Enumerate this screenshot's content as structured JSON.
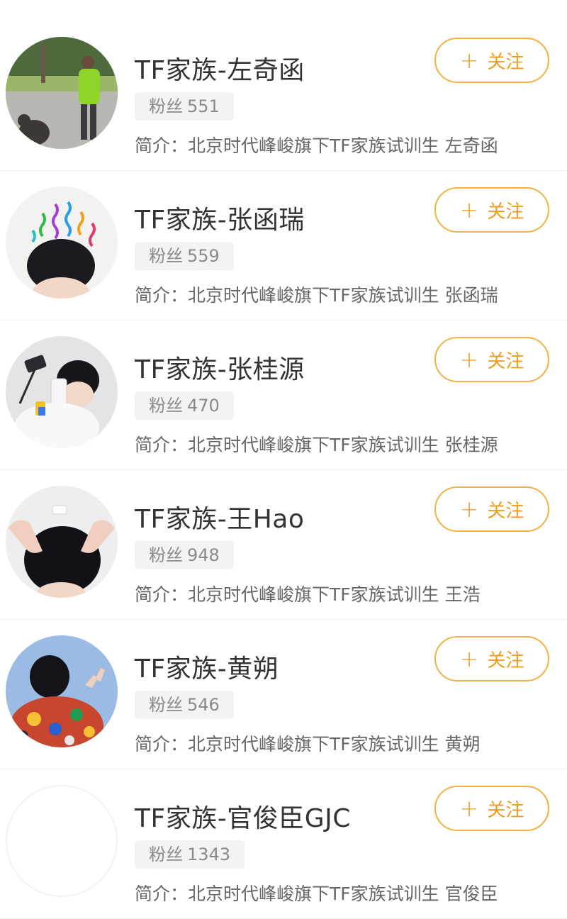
{
  "users": [
    {
      "name": "TF家族-左奇函",
      "fans_label": "粉丝",
      "fans_count": "551",
      "bio": "简介：北京时代峰峻旗下TF家族试训生 左奇函",
      "follow_label": "关注",
      "avatar": "photo-boy-park-with-dog"
    },
    {
      "name": "TF家族-张函瑞",
      "fans_label": "粉丝",
      "fans_count": "559",
      "bio": "简介：北京时代峰峻旗下TF家族试训生 张函瑞",
      "follow_label": "关注",
      "avatar": "photo-boy-colorful-spirals"
    },
    {
      "name": "TF家族-张桂源",
      "fans_label": "粉丝",
      "fans_count": "470",
      "bio": "简介：北京时代峰峻旗下TF家族试训生 张桂源",
      "follow_label": "关注",
      "avatar": "photo-boy-selfie-phone"
    },
    {
      "name": "TF家族-王Hao",
      "fans_label": "粉丝",
      "fans_count": "948",
      "bio": "简介：北京时代峰峻旗下TF家族试训生 王浩",
      "follow_label": "关注",
      "avatar": "photo-boy-hands-on-head"
    },
    {
      "name": "TF家族-黄朔",
      "fans_label": "粉丝",
      "fans_count": "546",
      "bio": "简介：北京时代峰峻旗下TF家族试训生 黄朔",
      "follow_label": "关注",
      "avatar": "photo-boy-back-colorful-jacket"
    },
    {
      "name": "TF家族-官俊臣GJC",
      "fans_label": "粉丝",
      "fans_count": "1343",
      "bio": "简介：北京时代峰峻旗下TF家族试训生 官俊臣",
      "follow_label": "关注",
      "avatar": "blank"
    }
  ],
  "follow_icon": "plus-icon",
  "colors": {
    "accent": "#f19b1c",
    "accent_border": "#f5b043",
    "fans_badge_bg": "#f3f3f3",
    "divider": "#eeeeee"
  }
}
